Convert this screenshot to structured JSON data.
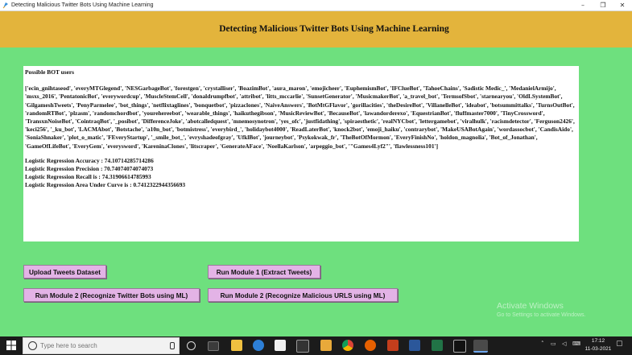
{
  "window": {
    "title": "Detecting Malicious Twitter Bots Using Machine Learning",
    "minimize": "–",
    "maximize": "❐",
    "close": "✕"
  },
  "header": {
    "title": "Detecting Malicious Twitter Bots Using Machine Learning"
  },
  "output": {
    "heading": "Possible BOT users",
    "bot_list": "['ecin_gnihtaseod', 'everyMTGlegend', 'NESGarbageBot', 'forestgen', 'crystalliser', 'BoazimBot', 'aura_maron', 'emojicheer', 'EuphemismBot', 'IFClueBot', 'TahoeChains', 'Sadistic Medic_', 'MedanielArmijo', 'msxs_2016', 'PentatonicBot', 'everywordcup', 'MuscleStemCell', 'donaldrumpfbot', 'attribot', 'litts_mccarlie', 'SunsetGenerator', 'MusicmakerBot', 'a_travel_bot', 'TermsofSbot', 'starnearyou', 'OldLSystemBot', 'GilgameshTweets', 'PenyParmelee', 'bot_things', 'netflixtaglines', 'bonquetbot', 'pizzaclones', 'NaiveAnswers', 'BotMtGFlavor', 'gorillacities', 'theDesireBot', 'VillanelleBot', 'ideabot', 'botsummittalks', 'TurnsOutBot', 'randomRTBot', 'plzasm', 'randomchordbot', 'yourehereebot', 'wearable_things', 'haikuthegibson', 'MusicReviewBot', 'BecauseBot', 'lawandorderexo', 'EquestrianBot', 'fluffmaster7000', 'TinyCrossword', 'TransxnNoiseBot', 'CointraqBot', '_posibot', 'DifferenceJoke', 'abotcalledquest', 'mnemosynotron', 'yes_ofc', 'justfidathing', 'spiraesthetic', 'realNYCbot', 'lettergamebot', 'viralhulk', 'racismdetector', 'Ferguson2426', 'keci256', '_ku_bot', 'LACMAbot', 'Botstache', 'a10n_bot', 'botmistress', 'everybird_', 'holidaybot4000', 'ReadLaterBot', 'knock2bot', 'emoji_haiku', 'contrarybot', 'MakeUSABotAgain', 'wordassocbot', 'CandisAido', 'SoniaShnaker', 'plot_o_matic', 'FEveryStartup', '_smile_bot_', 'evryshadeofgray', 'UfklBot', 'journeybot', 'Psykokwak_fr', 'TheBotOfMormon', 'EveryFinishNo', 'holdon_magnolia', 'Bot_of_Jonathan', 'GameOfLifeBot', 'EveryGem', 'everysword', 'KareninaClones', 'litscraper', 'GenerateAFace', 'NoellaKarlson', 'arpeggio_bot', '\"Games4Lyf2\"', 'flawlessness101']",
    "accuracy": "Logistic Regression Accuracy  : 74.10714285714286",
    "precision": "Logistic Regression Precision : 70.74074074074073",
    "recall": "Logistic Regression Recall is : 74.31906614785993",
    "auc": "Logistic Regression Area Under Curve is : 0.7412322944356693"
  },
  "buttons": {
    "upload": "Upload Tweets Dataset",
    "module1": "Run Module 1 (Extract Tweets)",
    "module2_bots": "Run Module 2 (Recognize Twitter Bots using ML)",
    "module2_urls": "Run Module 2 (Recognize Malicious URLS using ML)"
  },
  "watermark": {
    "line1": "Activate Windows",
    "line2": "Go to Settings to activate Windows."
  },
  "taskbar": {
    "search_placeholder": "Type here to search",
    "time": "17:12",
    "date": "11-03-2021",
    "icons": [
      "task-view-icon",
      "file-explorer-icon",
      "edge-icon",
      "store-icon",
      "folder-icon",
      "chrome-icon",
      "firefox-icon",
      "powerpoint-icon",
      "word-icon",
      "excel-icon",
      "terminal-icon",
      "python-icon"
    ]
  },
  "colors": {
    "background": "#6ee07e",
    "header": "#e3b43c",
    "button": "#e3b3e6"
  }
}
